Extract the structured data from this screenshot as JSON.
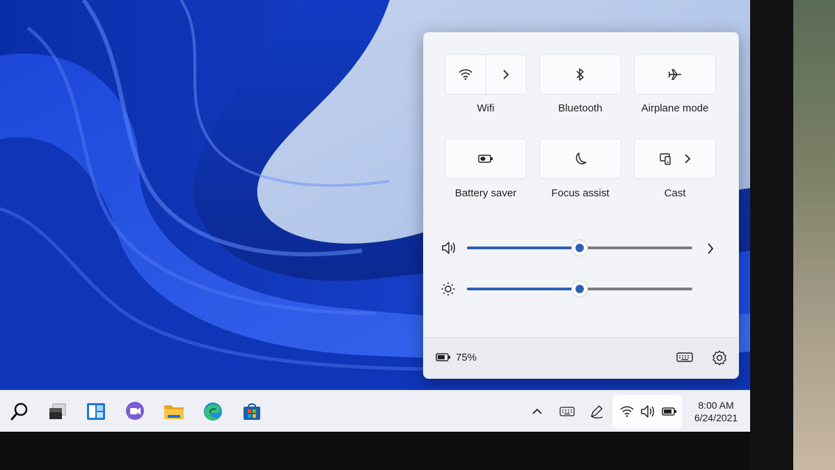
{
  "quick_settings": {
    "tiles": [
      {
        "label": "Wifi",
        "icon": "wifi-icon",
        "has_chevron": true
      },
      {
        "label": "Bluetooth",
        "icon": "bluetooth-icon",
        "has_chevron": false
      },
      {
        "label": "Airplane mode",
        "icon": "airplane-icon",
        "has_chevron": false
      },
      {
        "label": "Battery saver",
        "icon": "battery-saver-icon",
        "has_chevron": false
      },
      {
        "label": "Focus assist",
        "icon": "moon-icon",
        "has_chevron": false
      },
      {
        "label": "Cast",
        "icon": "cast-icon",
        "has_chevron": true
      }
    ],
    "volume": {
      "level_percent": 50,
      "icon": "speaker-icon"
    },
    "brightness": {
      "level_percent": 50,
      "icon": "sun-icon"
    },
    "battery_percent": "75%",
    "accent_color": "#2c5fb5"
  },
  "taskbar": {
    "apps": [
      "search-icon",
      "task-view-icon",
      "widgets-icon",
      "teams-chat-icon",
      "file-explorer-icon",
      "edge-icon",
      "store-icon"
    ],
    "tray": [
      "chevron-up-icon",
      "keyboard-icon",
      "pen-icon",
      "wifi-icon",
      "speaker-icon",
      "battery-icon"
    ],
    "time": "8:00 AM",
    "date": "6/24/2021"
  }
}
